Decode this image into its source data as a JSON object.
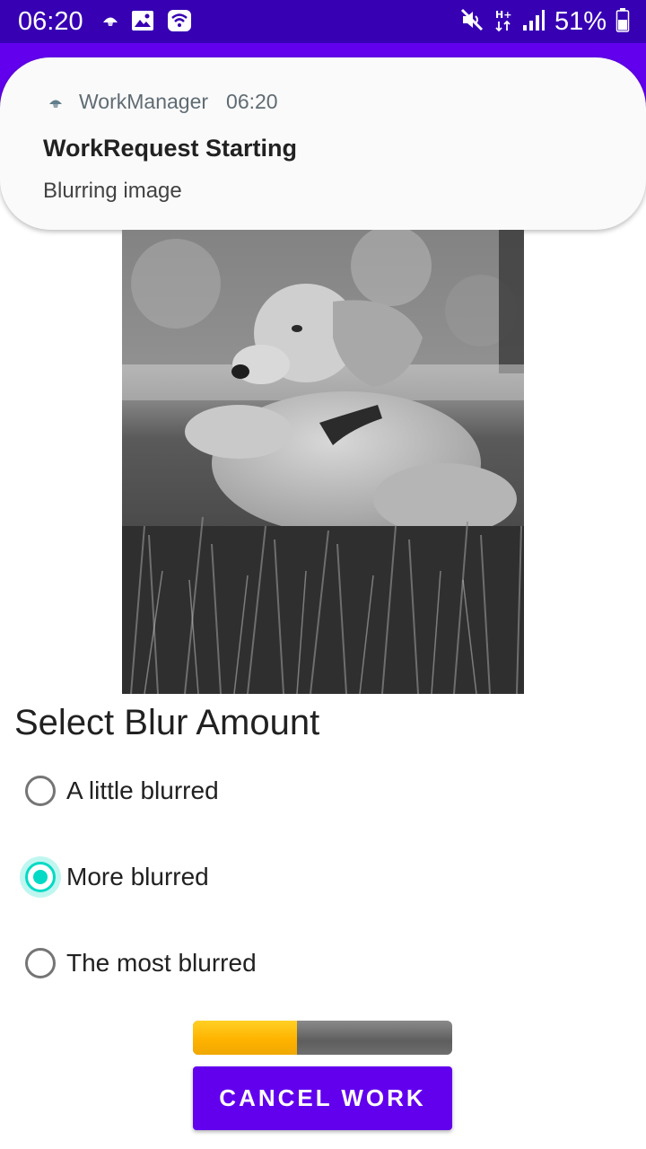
{
  "status_bar": {
    "time": "06:20",
    "battery_percent": "51%",
    "left_icons": [
      "workmanager-app-icon",
      "image-icon",
      "wifi-calling-icon"
    ],
    "right_icons": [
      "mute-icon",
      "hplus-data-icon",
      "signal-icon",
      "battery-icon"
    ]
  },
  "notification": {
    "app_name": "WorkManager",
    "time": "06:20",
    "title": "WorkRequest Starting",
    "text": "Blurring image"
  },
  "blur_section": {
    "title": "Select Blur Amount",
    "options": [
      {
        "label": "A little blurred",
        "checked": false
      },
      {
        "label": "More blurred",
        "checked": true
      },
      {
        "label": "The most blurred",
        "checked": false
      }
    ]
  },
  "progress": {
    "value": 0.4
  },
  "cancel_label": "CANCEL WORK",
  "colors": {
    "status_bar": "#3700b3",
    "primary": "#6200ee",
    "accent": "#03dac5",
    "progress_fill": "#ffb300"
  }
}
